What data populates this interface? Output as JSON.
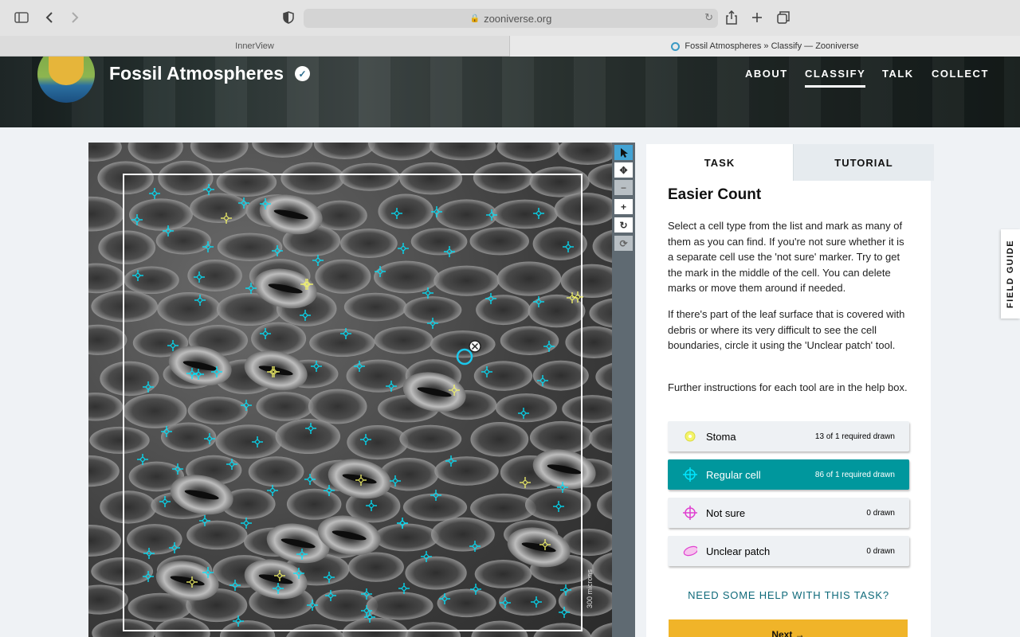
{
  "browser": {
    "url": "zooniverse.org",
    "tabs": [
      {
        "label": "InnerView"
      },
      {
        "label": "Fossil Atmospheres » Classify — Zooniverse"
      }
    ]
  },
  "project": {
    "title": "Fossil Atmospheres",
    "nav": [
      {
        "label": "ABOUT"
      },
      {
        "label": "CLASSIFY",
        "active": true
      },
      {
        "label": "TALK"
      },
      {
        "label": "COLLECT"
      }
    ]
  },
  "viewer": {
    "scale_label": "300 microns",
    "tools": [
      "pointer-icon",
      "move-icon",
      "zoom-out-icon",
      "zoom-in-icon",
      "rotate-icon",
      "reset-icon"
    ]
  },
  "task_panel": {
    "tabs": [
      {
        "label": "TASK"
      },
      {
        "label": "TUTORIAL"
      }
    ],
    "title": "Easier Count",
    "instructions": [
      "Select a cell type from the list and mark as many of them as you can find. If you're not sure whether it is a separate cell use the 'not sure' marker. Try to get the mark in the middle of the cell. You can delete marks or move them around if needed.",
      "If there's part of the leaf surface that is covered with debris or where its very difficult to see the cell boundaries, circle it using the 'Unclear patch' tool.",
      "Further instructions for each tool are in the help box."
    ],
    "tools": [
      {
        "name": "Stoma",
        "count": "13 of 1 required drawn",
        "color": "#f4f46a",
        "icon": "stoma-icon"
      },
      {
        "name": "Regular cell",
        "count": "86 of 1 required drawn",
        "color": "#00e5ff",
        "icon": "crosshair-icon",
        "selected": true
      },
      {
        "name": "Not sure",
        "count": "0 drawn",
        "color": "#e040d0",
        "icon": "crosshair-icon"
      },
      {
        "name": "Unclear patch",
        "count": "0 drawn",
        "color": "#e040d0",
        "icon": "ellipse-icon"
      }
    ],
    "help_link": "NEED SOME HELP WITH THIS TASK?",
    "next_label": "Next →"
  },
  "field_guide_label": "FIELD GUIDE"
}
